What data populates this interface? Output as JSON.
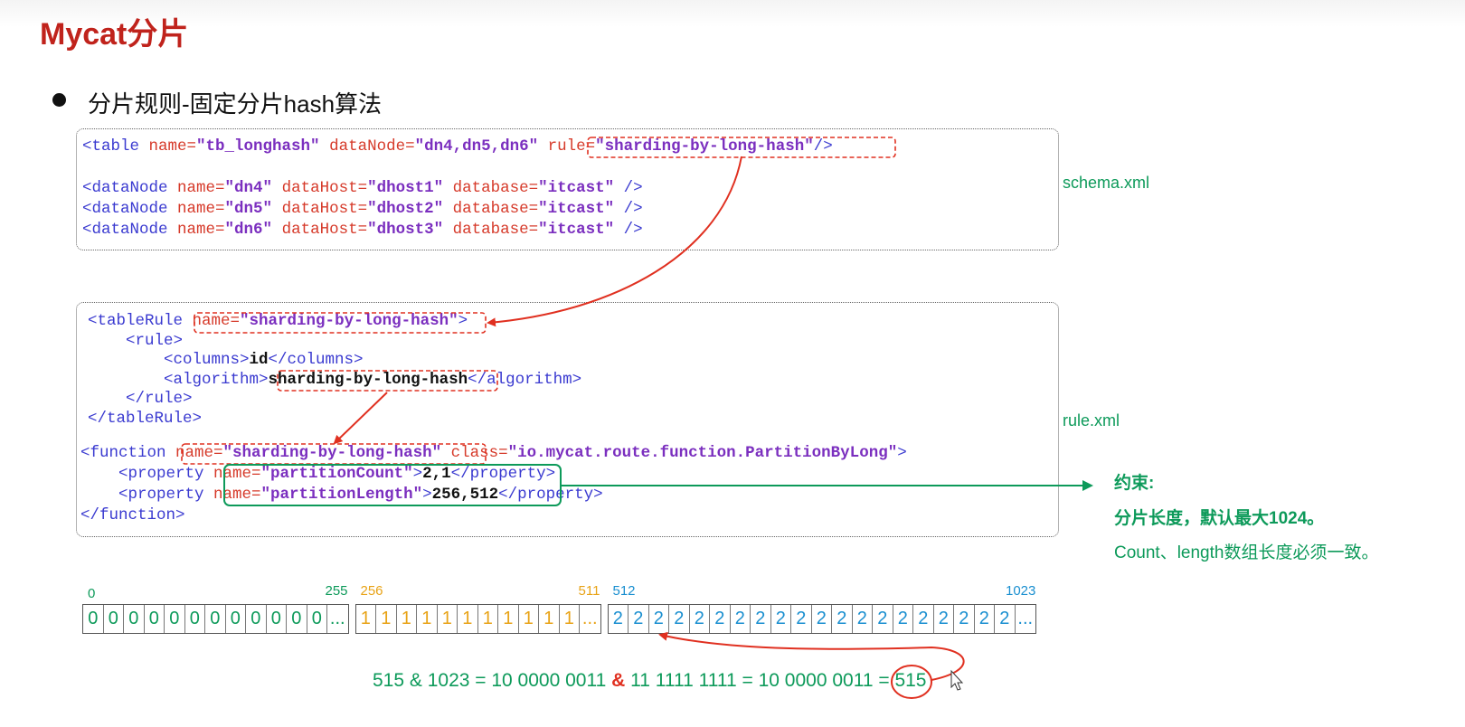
{
  "title": "Mycat分片",
  "bullet": "分片规则-固定分片hash算法",
  "labels": {
    "schema": "schema.xml",
    "rule": "rule.xml"
  },
  "schema_lines": [
    [
      [
        "tag",
        "<table "
      ],
      [
        "attr",
        "name="
      ],
      [
        "val",
        "\"tb_longhash\""
      ],
      [
        "attr",
        " dataNode="
      ],
      [
        "val",
        "\"dn4,dn5,dn6\""
      ],
      [
        "tag",
        " "
      ],
      [
        "attr",
        "rule="
      ],
      [
        "val",
        "\"sharding-by-long-hash\""
      ],
      [
        "tag",
        "/>"
      ]
    ],
    [],
    [
      [
        "tag",
        "<dataNode "
      ],
      [
        "attr",
        "name="
      ],
      [
        "val",
        "\"dn4\""
      ],
      [
        "attr",
        " dataHost="
      ],
      [
        "val",
        "\"dhost1\""
      ],
      [
        "attr",
        " database="
      ],
      [
        "val",
        "\"itcast\""
      ],
      [
        "tag",
        " />"
      ]
    ],
    [
      [
        "tag",
        "<dataNode "
      ],
      [
        "attr",
        "name="
      ],
      [
        "val",
        "\"dn5\""
      ],
      [
        "attr",
        " dataHost="
      ],
      [
        "val",
        "\"dhost2\""
      ],
      [
        "attr",
        " database="
      ],
      [
        "val",
        "\"itcast\""
      ],
      [
        "tag",
        " />"
      ]
    ],
    [
      [
        "tag",
        "<dataNode "
      ],
      [
        "attr",
        "name="
      ],
      [
        "val",
        "\"dn6\""
      ],
      [
        "attr",
        " dataHost="
      ],
      [
        "val",
        "\"dhost3\""
      ],
      [
        "attr",
        " database="
      ],
      [
        "val",
        "\"itcast\""
      ],
      [
        "tag",
        " />"
      ]
    ]
  ],
  "rule_lines": [
    [
      [
        "tag",
        "<tableRule "
      ],
      [
        "attr",
        "name="
      ],
      [
        "val",
        "\"sharding-by-long-hash\""
      ],
      [
        "tag",
        ">"
      ]
    ],
    [
      [
        "tag",
        "    <rule>"
      ]
    ],
    [
      [
        "tag",
        "        <columns>"
      ],
      [
        "txt",
        "id"
      ],
      [
        "tag",
        "</columns>"
      ]
    ],
    [
      [
        "tag",
        "        <algorithm>"
      ],
      [
        "txt",
        "sharding-by-long-hash"
      ],
      [
        "tag",
        "</algorithm>"
      ]
    ],
    [
      [
        "tag",
        "    </rule>"
      ]
    ],
    [
      [
        "tag",
        "</tableRule>"
      ]
    ]
  ],
  "function_lines": [
    [
      [
        "tag",
        "<function "
      ],
      [
        "attr",
        "name="
      ],
      [
        "val",
        "\"sharding-by-long-hash\""
      ],
      [
        "tag",
        " "
      ],
      [
        "attr",
        "class="
      ],
      [
        "val",
        "\"io.mycat.route.function.PartitionByLong\""
      ],
      [
        "tag",
        ">"
      ]
    ],
    [
      [
        "tag",
        "    <property "
      ],
      [
        "attr",
        "name="
      ],
      [
        "val",
        "\"partitionCount\""
      ],
      [
        "tag",
        ">"
      ],
      [
        "txt",
        "2,1"
      ],
      [
        "tag",
        "</property>"
      ]
    ],
    [
      [
        "tag",
        "    <property "
      ],
      [
        "attr",
        "name="
      ],
      [
        "val",
        "\"partitionLength\""
      ],
      [
        "tag",
        ">"
      ],
      [
        "txt",
        "256,512"
      ],
      [
        "tag",
        "</property>"
      ]
    ],
    [
      [
        "tag",
        "</function>"
      ]
    ]
  ],
  "constraint": {
    "heading": "约束:",
    "line1": "分片长度，默认最大1024。",
    "line2": "Count、length数组长度必须一致。"
  },
  "segments": [
    {
      "start_label": "0",
      "end_label": "255",
      "digit": "0",
      "count": 12,
      "color": "#0d9a5a"
    },
    {
      "start_label": "256",
      "end_label": "511",
      "digit": "1",
      "count": 11,
      "color": "#e8a317"
    },
    {
      "start_label": "512",
      "end_label": "1023",
      "digit": "2",
      "count": 20,
      "color": "#1a8fd0"
    }
  ],
  "ellipsis": "...",
  "formula": {
    "left": "515 & 1023 = 10 0000 0011 ",
    "amp": "&",
    "right": " 11 1111 1111 = 10 0000 0011 = ",
    "result": "515"
  },
  "colors": {
    "title": "#c0231c",
    "red_arrow": "#e03020",
    "green_box": "#0d9a5a"
  }
}
